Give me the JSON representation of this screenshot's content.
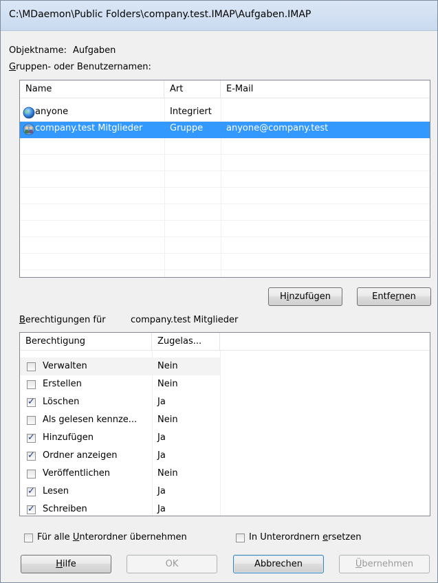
{
  "window": {
    "title": "C:\\MDaemon\\Public Folders\\company.test.IMAP\\Aufgaben.IMAP"
  },
  "object": {
    "label": "Objektname:",
    "value": "Aufgaben"
  },
  "groups": {
    "label": "Gruppen- oder Benutzernamen:",
    "columns": [
      "Name",
      "Art",
      "E-Mail"
    ],
    "rows": [
      {
        "name": "anyone",
        "type": "Integriert",
        "email": "",
        "icon": "globe-icon"
      },
      {
        "name": "company.test Mitglieder",
        "type": "Gruppe",
        "email": "anyone@company.test",
        "icon": "group-icon",
        "selected": true
      }
    ],
    "add_button": "Hinzufügen",
    "remove_button": "Entfernen"
  },
  "permissions": {
    "label_prefix": "Berechtigungen für",
    "label_target": "company.test Mitglieder",
    "columns": [
      "Berechtigung",
      "Zugelas..."
    ],
    "rows": [
      {
        "name": "Verwalten",
        "allowed": "Nein",
        "checked": false
      },
      {
        "name": "Erstellen",
        "allowed": "Nein",
        "checked": false
      },
      {
        "name": "Löschen",
        "allowed": "Ja",
        "checked": true
      },
      {
        "name": "Als gelesen kennze...",
        "allowed": "Nein",
        "checked": false
      },
      {
        "name": "Hinzufügen",
        "allowed": "Ja",
        "checked": true
      },
      {
        "name": "Ordner anzeigen",
        "allowed": "Ja",
        "checked": true
      },
      {
        "name": "Veröffentlichen",
        "allowed": "Nein",
        "checked": false
      },
      {
        "name": "Lesen",
        "allowed": "Ja",
        "checked": true
      },
      {
        "name": "Schreiben",
        "allowed": "Ja",
        "checked": true
      }
    ]
  },
  "options": {
    "apply_all": "Für alle Unterordner übernehmen",
    "replace_sub": "In Unterordnern ersetzen"
  },
  "footer": {
    "help": "Hilfe",
    "ok": "OK",
    "cancel": "Abbrechen",
    "apply": "Übernehmen"
  },
  "colors": {
    "selection": "#3399ff",
    "checkmark": "#1f3f83"
  }
}
